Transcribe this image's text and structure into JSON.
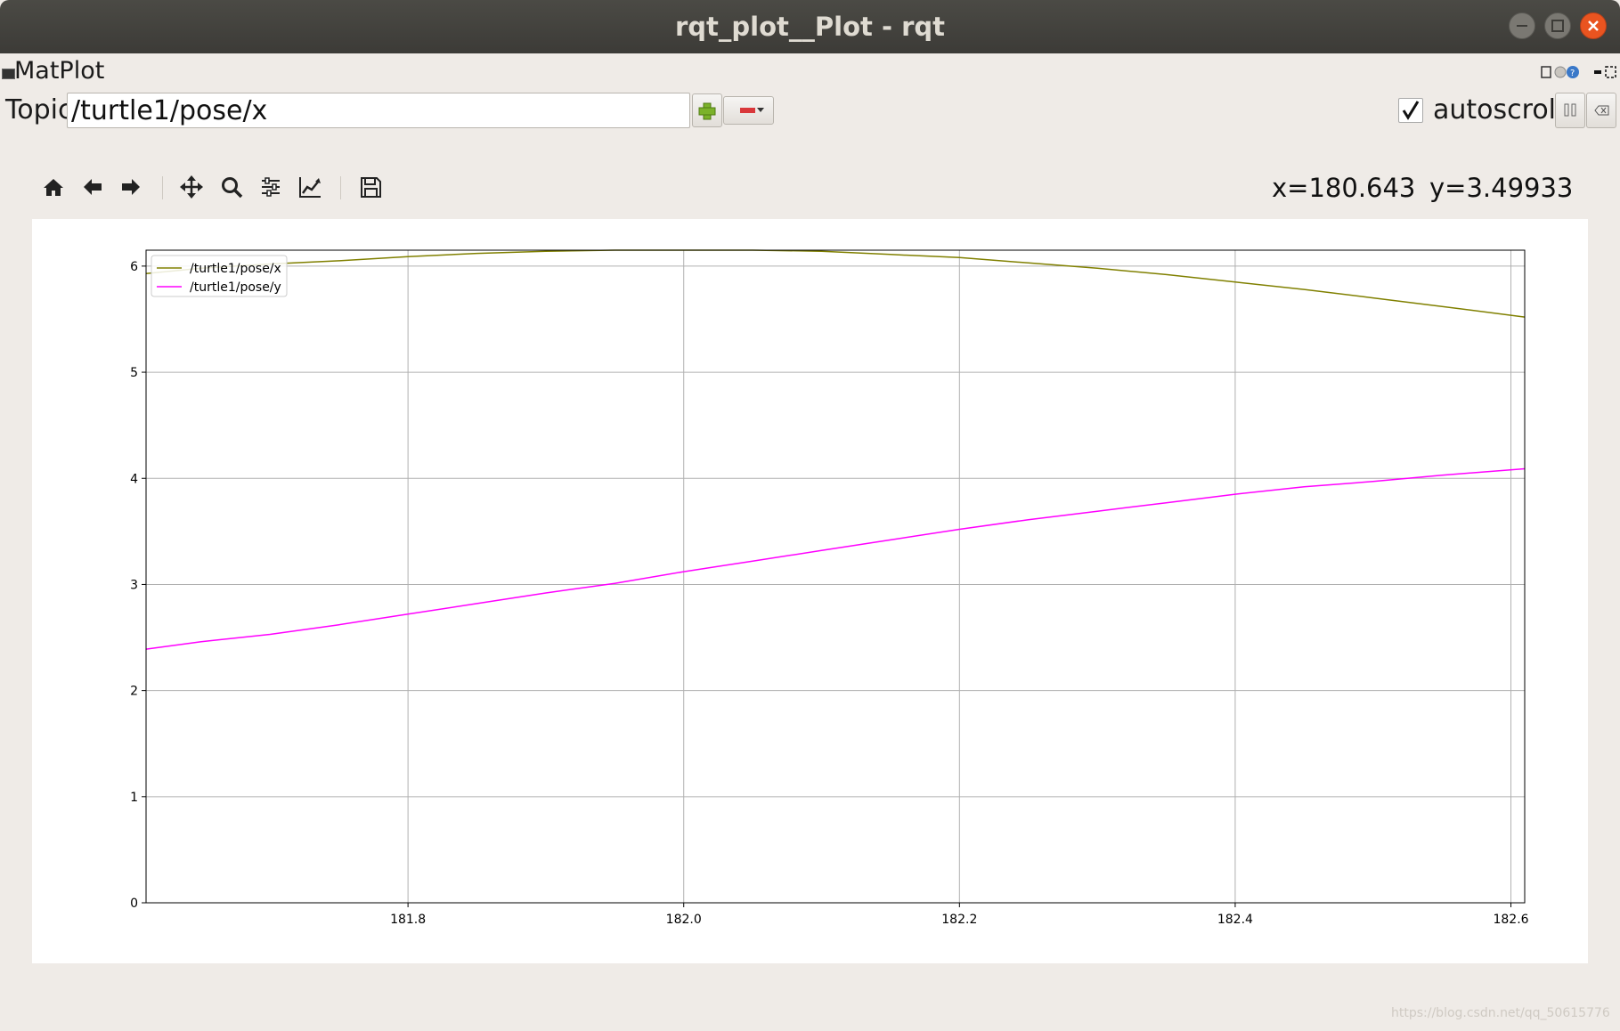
{
  "window": {
    "title": "rqt_plot__Plot - rqt"
  },
  "plugin": {
    "title": "MatPlot"
  },
  "topic_row": {
    "label": "Topic",
    "input_value": "/turtle1/pose/x",
    "autoscroll_label": "autoscroll",
    "autoscroll_checked": true
  },
  "toolbar": {
    "icons": [
      "home-icon",
      "back-arrow-icon",
      "forward-arrow-icon",
      "pan-icon",
      "zoom-icon",
      "subplots-config-icon",
      "curve-edit-icon",
      "save-icon"
    ],
    "x_readout": "x=180.643",
    "y_readout": "y=3.49933"
  },
  "watermark": "https://blog.csdn.net/qq_50615776",
  "chart_data": {
    "type": "line",
    "xlim": [
      181.61,
      182.61
    ],
    "ylim": [
      0,
      6.15
    ],
    "grid": true,
    "legend_position": "top-left",
    "x_ticks": [
      181.8,
      182.0,
      182.2,
      182.4,
      182.6
    ],
    "x_tick_labels": [
      "181.8",
      "182.0",
      "182.2",
      "182.4",
      "182.6"
    ],
    "y_ticks": [
      0,
      1,
      2,
      3,
      4,
      5,
      6
    ],
    "y_tick_labels": [
      "0",
      "1",
      "2",
      "3",
      "4",
      "5",
      "6"
    ],
    "series": [
      {
        "name": "/turtle1/pose/x",
        "color": "#808000",
        "x": [
          181.61,
          181.65,
          181.7,
          181.75,
          181.8,
          181.85,
          181.9,
          181.95,
          182.0,
          182.05,
          182.1,
          182.15,
          182.2,
          182.25,
          182.3,
          182.35,
          182.4,
          182.45,
          182.5,
          182.55,
          182.61
        ],
        "y": [
          5.93,
          5.98,
          6.02,
          6.05,
          6.09,
          6.12,
          6.14,
          6.15,
          6.16,
          6.15,
          6.14,
          6.11,
          6.08,
          6.03,
          5.98,
          5.92,
          5.85,
          5.78,
          5.7,
          5.62,
          5.52
        ]
      },
      {
        "name": "/turtle1/pose/y",
        "color": "#ff00ff",
        "x": [
          181.61,
          181.65,
          181.7,
          181.75,
          181.8,
          181.85,
          181.9,
          181.95,
          182.0,
          182.05,
          182.1,
          182.15,
          182.2,
          182.25,
          182.3,
          182.35,
          182.4,
          182.45,
          182.5,
          182.55,
          182.61
        ],
        "y": [
          2.39,
          2.46,
          2.53,
          2.62,
          2.72,
          2.82,
          2.92,
          3.01,
          3.12,
          3.22,
          3.32,
          3.42,
          3.52,
          3.61,
          3.69,
          3.77,
          3.85,
          3.92,
          3.97,
          4.03,
          4.09
        ]
      }
    ]
  }
}
